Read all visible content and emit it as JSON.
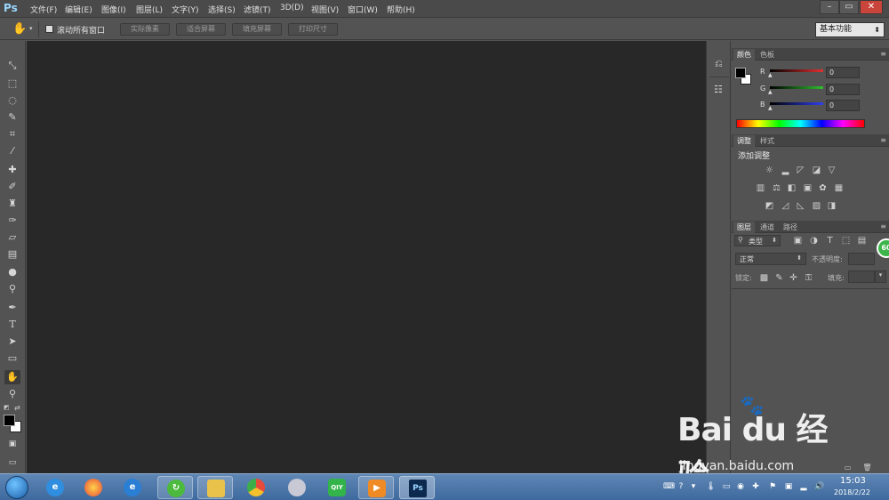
{
  "app": {
    "logo": "Ps"
  },
  "menu": [
    "文件(F)",
    "编辑(E)",
    "图像(I)",
    "图层(L)",
    "文字(Y)",
    "选择(S)",
    "滤镜(T)",
    "3D(D)",
    "视图(V)",
    "窗口(W)",
    "帮助(H)"
  ],
  "window_controls": {
    "minimize": "–",
    "restore": "▭",
    "close": "✕"
  },
  "options_bar": {
    "checkbox_label": "滚动所有窗口",
    "buttons": [
      "实际像素",
      "适合屏幕",
      "填充屏幕",
      "打印尺寸"
    ],
    "workspace": "基本功能"
  },
  "color_panel": {
    "tabs": [
      "颜色",
      "色板"
    ],
    "channels": [
      {
        "label": "R",
        "value": "0",
        "color": "#e23030"
      },
      {
        "label": "G",
        "value": "0",
        "color": "#2fbf2f"
      },
      {
        "label": "B",
        "value": "0",
        "color": "#2f3ff0"
      }
    ]
  },
  "adjust_panel": {
    "tabs": [
      "调整",
      "样式"
    ],
    "title": "添加调整"
  },
  "layers_panel": {
    "tabs": [
      "图层",
      "通道",
      "路径"
    ],
    "filter_label": "类型",
    "blend_mode": "正常",
    "opacity_label": "不透明度:",
    "lock_label": "锁定:",
    "fill_label": "填充:"
  },
  "badge": {
    "value": "60",
    "color": "#3cb54a"
  },
  "taskbar": {
    "time": "15:03",
    "date": "2018/2/22",
    "apps": [
      "ie-icon",
      "360-icon",
      "ie2-icon",
      "refresh-icon",
      "folder-icon",
      "chrome-icon",
      "network-icon",
      "iqiyi-icon",
      "video-icon",
      "photoshop-icon"
    ]
  },
  "watermark": {
    "main": "Bai du 经验",
    "url": "jingyan.baidu.com"
  }
}
